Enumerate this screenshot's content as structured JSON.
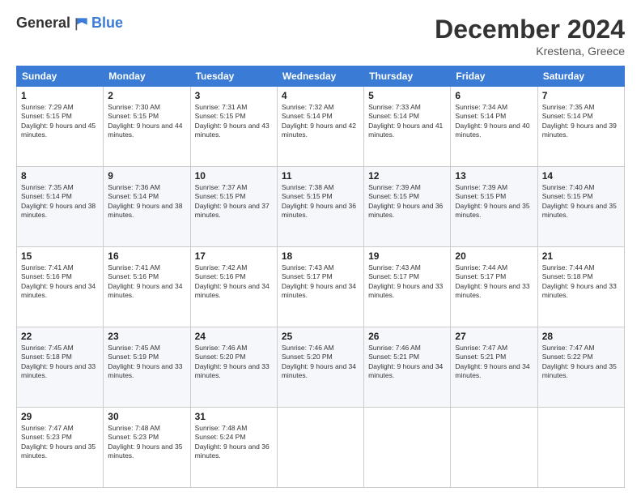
{
  "header": {
    "logo_general": "General",
    "logo_blue": "Blue",
    "month_title": "December 2024",
    "location": "Krestena, Greece"
  },
  "weekdays": [
    "Sunday",
    "Monday",
    "Tuesday",
    "Wednesday",
    "Thursday",
    "Friday",
    "Saturday"
  ],
  "weeks": [
    [
      {
        "day": "1",
        "sunrise": "7:29 AM",
        "sunset": "5:15 PM",
        "daylight": "9 hours and 45 minutes."
      },
      {
        "day": "2",
        "sunrise": "7:30 AM",
        "sunset": "5:15 PM",
        "daylight": "9 hours and 44 minutes."
      },
      {
        "day": "3",
        "sunrise": "7:31 AM",
        "sunset": "5:15 PM",
        "daylight": "9 hours and 43 minutes."
      },
      {
        "day": "4",
        "sunrise": "7:32 AM",
        "sunset": "5:14 PM",
        "daylight": "9 hours and 42 minutes."
      },
      {
        "day": "5",
        "sunrise": "7:33 AM",
        "sunset": "5:14 PM",
        "daylight": "9 hours and 41 minutes."
      },
      {
        "day": "6",
        "sunrise": "7:34 AM",
        "sunset": "5:14 PM",
        "daylight": "9 hours and 40 minutes."
      },
      {
        "day": "7",
        "sunrise": "7:35 AM",
        "sunset": "5:14 PM",
        "daylight": "9 hours and 39 minutes."
      }
    ],
    [
      {
        "day": "8",
        "sunrise": "7:35 AM",
        "sunset": "5:14 PM",
        "daylight": "9 hours and 38 minutes."
      },
      {
        "day": "9",
        "sunrise": "7:36 AM",
        "sunset": "5:14 PM",
        "daylight": "9 hours and 38 minutes."
      },
      {
        "day": "10",
        "sunrise": "7:37 AM",
        "sunset": "5:15 PM",
        "daylight": "9 hours and 37 minutes."
      },
      {
        "day": "11",
        "sunrise": "7:38 AM",
        "sunset": "5:15 PM",
        "daylight": "9 hours and 36 minutes."
      },
      {
        "day": "12",
        "sunrise": "7:39 AM",
        "sunset": "5:15 PM",
        "daylight": "9 hours and 36 minutes."
      },
      {
        "day": "13",
        "sunrise": "7:39 AM",
        "sunset": "5:15 PM",
        "daylight": "9 hours and 35 minutes."
      },
      {
        "day": "14",
        "sunrise": "7:40 AM",
        "sunset": "5:15 PM",
        "daylight": "9 hours and 35 minutes."
      }
    ],
    [
      {
        "day": "15",
        "sunrise": "7:41 AM",
        "sunset": "5:16 PM",
        "daylight": "9 hours and 34 minutes."
      },
      {
        "day": "16",
        "sunrise": "7:41 AM",
        "sunset": "5:16 PM",
        "daylight": "9 hours and 34 minutes."
      },
      {
        "day": "17",
        "sunrise": "7:42 AM",
        "sunset": "5:16 PM",
        "daylight": "9 hours and 34 minutes."
      },
      {
        "day": "18",
        "sunrise": "7:43 AM",
        "sunset": "5:17 PM",
        "daylight": "9 hours and 34 minutes."
      },
      {
        "day": "19",
        "sunrise": "7:43 AM",
        "sunset": "5:17 PM",
        "daylight": "9 hours and 33 minutes."
      },
      {
        "day": "20",
        "sunrise": "7:44 AM",
        "sunset": "5:17 PM",
        "daylight": "9 hours and 33 minutes."
      },
      {
        "day": "21",
        "sunrise": "7:44 AM",
        "sunset": "5:18 PM",
        "daylight": "9 hours and 33 minutes."
      }
    ],
    [
      {
        "day": "22",
        "sunrise": "7:45 AM",
        "sunset": "5:18 PM",
        "daylight": "9 hours and 33 minutes."
      },
      {
        "day": "23",
        "sunrise": "7:45 AM",
        "sunset": "5:19 PM",
        "daylight": "9 hours and 33 minutes."
      },
      {
        "day": "24",
        "sunrise": "7:46 AM",
        "sunset": "5:20 PM",
        "daylight": "9 hours and 33 minutes."
      },
      {
        "day": "25",
        "sunrise": "7:46 AM",
        "sunset": "5:20 PM",
        "daylight": "9 hours and 34 minutes."
      },
      {
        "day": "26",
        "sunrise": "7:46 AM",
        "sunset": "5:21 PM",
        "daylight": "9 hours and 34 minutes."
      },
      {
        "day": "27",
        "sunrise": "7:47 AM",
        "sunset": "5:21 PM",
        "daylight": "9 hours and 34 minutes."
      },
      {
        "day": "28",
        "sunrise": "7:47 AM",
        "sunset": "5:22 PM",
        "daylight": "9 hours and 35 minutes."
      }
    ],
    [
      {
        "day": "29",
        "sunrise": "7:47 AM",
        "sunset": "5:23 PM",
        "daylight": "9 hours and 35 minutes."
      },
      {
        "day": "30",
        "sunrise": "7:48 AM",
        "sunset": "5:23 PM",
        "daylight": "9 hours and 35 minutes."
      },
      {
        "day": "31",
        "sunrise": "7:48 AM",
        "sunset": "5:24 PM",
        "daylight": "9 hours and 36 minutes."
      },
      null,
      null,
      null,
      null
    ]
  ]
}
